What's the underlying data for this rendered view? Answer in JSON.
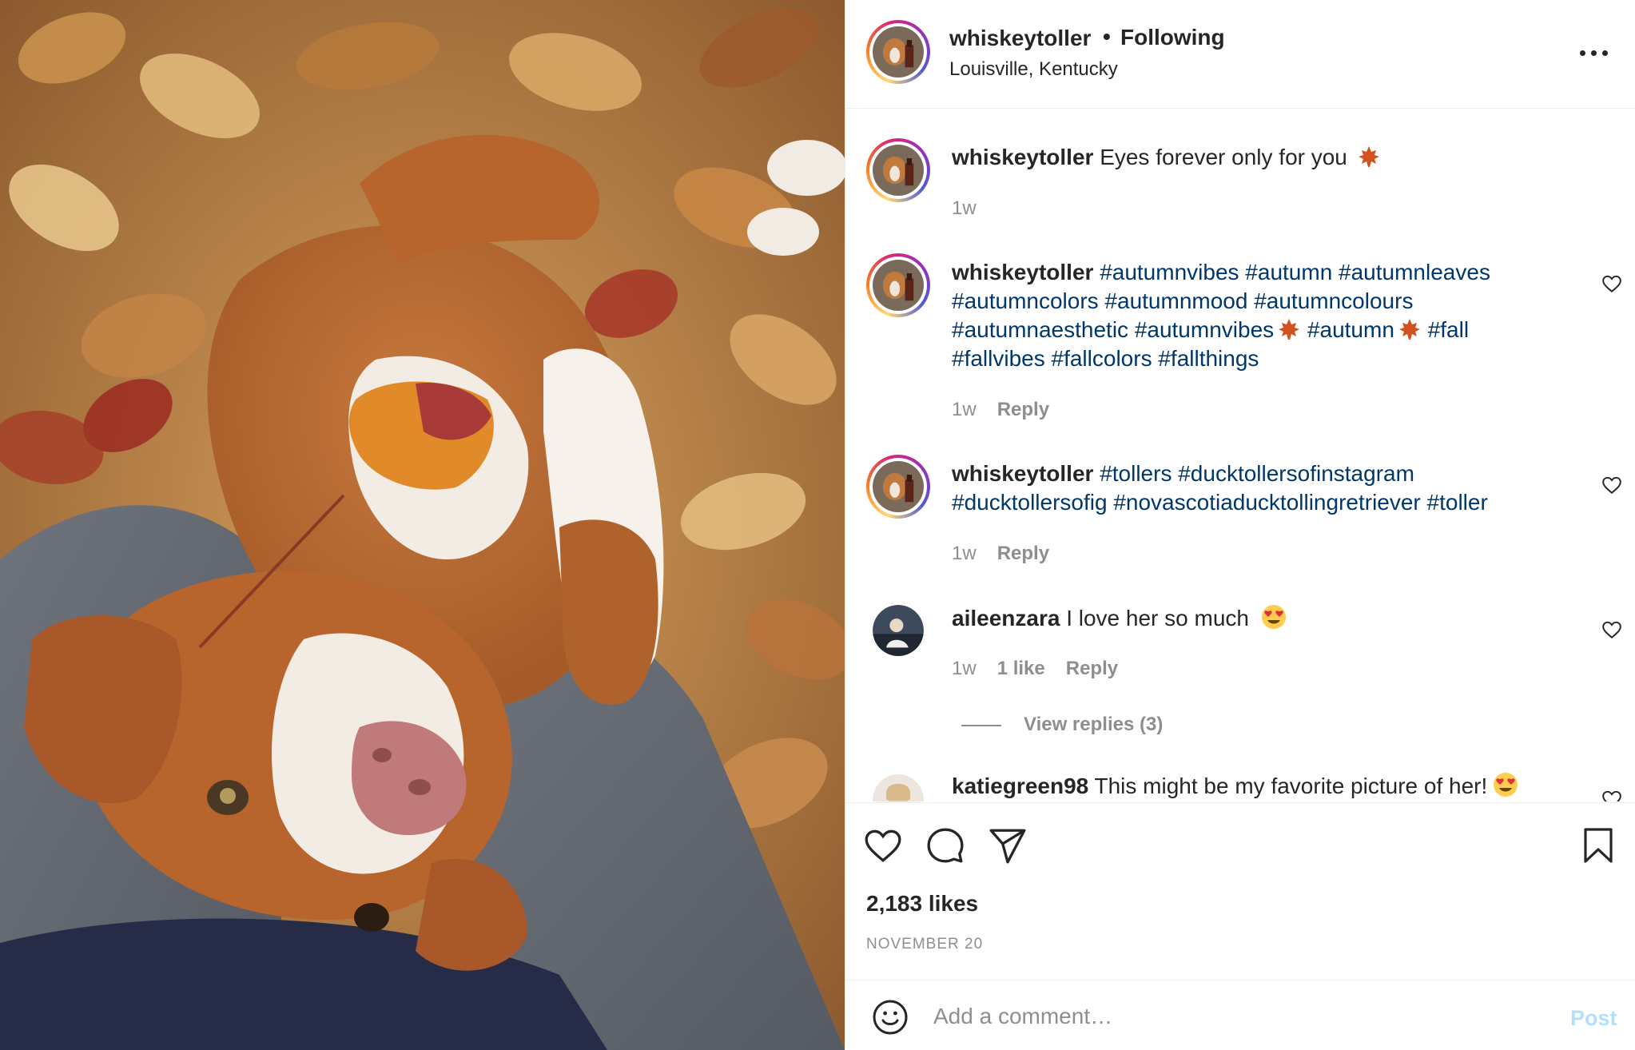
{
  "header": {
    "username": "whiskeytoller",
    "separator": "•",
    "follow_status": "Following",
    "location": "Louisville, Kentucky"
  },
  "caption": {
    "username": "whiskeytoller",
    "text": "Eyes forever only for you",
    "time": "1w"
  },
  "comments": [
    {
      "username": "whiskeytoller",
      "tags_line1": "#autumnvibes #autumn #autumnleaves",
      "tags_line2": "#autumncolors #autumnmood #autumncolours",
      "tags_line3a": "#autumnaesthetic #autumnvibes",
      "tags_line3b": "#autumn",
      "tags_line3c": "#fall",
      "tags_line4": "#fallvibes #fallcolors #fallthings",
      "time": "1w",
      "reply": "Reply"
    },
    {
      "username": "whiskeytoller",
      "tags_line1": "#tollers #ducktollersofinstagram",
      "tags_line2": "#ducktollersofig #novascotiaducktollingretriever #toller",
      "time": "1w",
      "reply": "Reply"
    },
    {
      "username": "aileenzara",
      "text": "I love her so much",
      "time": "1w",
      "likes": "1 like",
      "reply": "Reply",
      "view_replies": "View replies (3)"
    },
    {
      "username": "katiegreen98",
      "text": "This might be my favorite picture of her!"
    }
  ],
  "actions": {
    "likes": "2,183 likes",
    "date": "NOVEMBER 20"
  },
  "add_comment": {
    "placeholder": "Add a comment…",
    "post_label": "Post"
  },
  "colors": {
    "hashtag": "#00376b",
    "muted": "#8e8e8e",
    "post_disabled": "#b2dffc"
  },
  "icons": [
    "more-icon",
    "heart-icon",
    "comment-icon",
    "share-icon",
    "bookmark-icon",
    "emoji-icon",
    "maple-leaf-icon",
    "heart-eyes-emoji-icon"
  ]
}
